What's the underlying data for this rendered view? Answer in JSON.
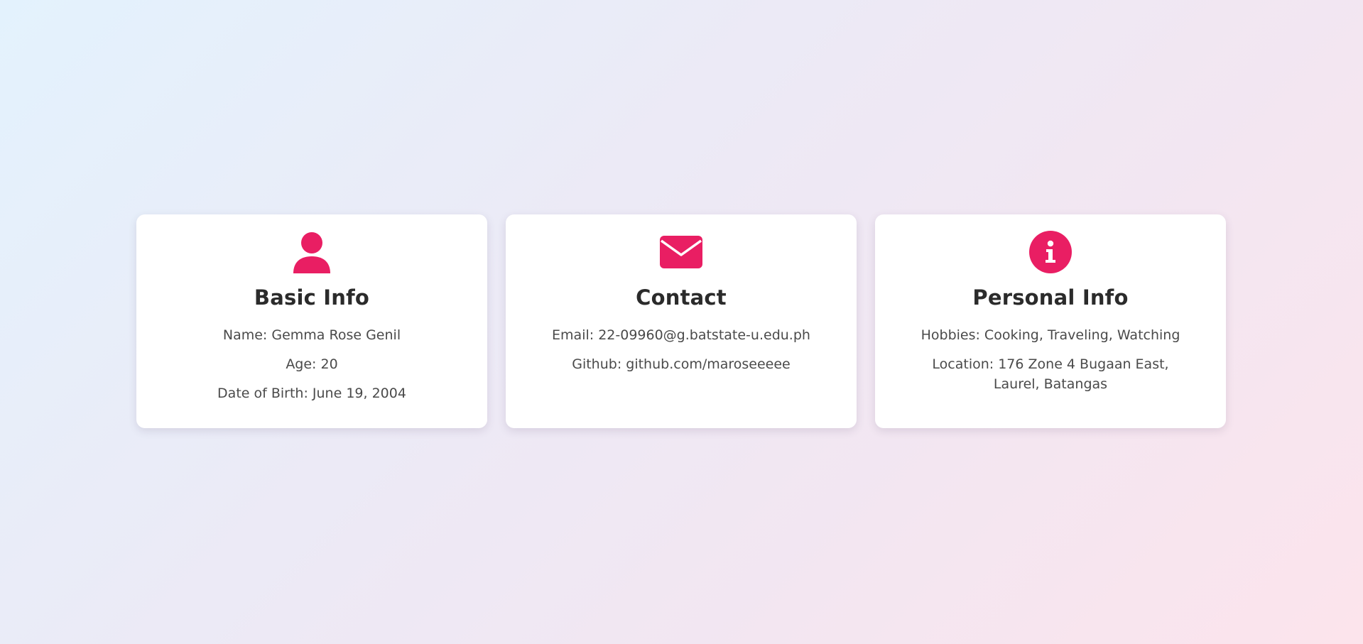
{
  "accent_color": "#e91e63",
  "cards": [
    {
      "title": "Basic Info",
      "icon": "user-icon",
      "lines": [
        "Name: Gemma Rose Genil",
        "Age: 20",
        "Date of Birth: June 19, 2004"
      ]
    },
    {
      "title": "Contact",
      "icon": "envelope-icon",
      "lines": [
        "Email: 22-09960@g.batstate-u.edu.ph",
        "Github: github.com/maroseeeee"
      ]
    },
    {
      "title": "Personal Info",
      "icon": "info-icon",
      "lines": [
        "Hobbies: Cooking, Traveling, Watching",
        "Location: 176 Zone 4 Bugaan East, Laurel, Batangas"
      ]
    }
  ]
}
